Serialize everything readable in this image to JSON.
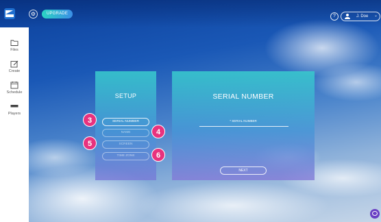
{
  "topbar": {
    "upgrade_label": "UPGRADE",
    "help_label": "?",
    "user_name": "J. Doe"
  },
  "sidebar": {
    "items": [
      {
        "label": "Files",
        "icon": "folder-icon"
      },
      {
        "label": "Create",
        "icon": "edit-icon"
      },
      {
        "label": "Schedule",
        "icon": "calendar-icon"
      },
      {
        "label": "Players",
        "icon": "player-icon"
      }
    ]
  },
  "setup": {
    "title": "SETUP",
    "steps": [
      {
        "label": "SERIAL NUMBER",
        "badge": "3"
      },
      {
        "label": "NAME",
        "badge": "4"
      },
      {
        "label": "SCREEN",
        "badge": "5"
      },
      {
        "label": "TIME ZONE",
        "badge": "6"
      }
    ]
  },
  "serial": {
    "title": "SERIAL NUMBER",
    "field_label": "* SERIAL NUMBER",
    "field_value": "",
    "next_label": "NEXT"
  },
  "colors": {
    "badge": "#e8327e",
    "panel_top": "#38cacd",
    "panel_bottom": "#7878d7",
    "chat": "#6a3fc4"
  }
}
